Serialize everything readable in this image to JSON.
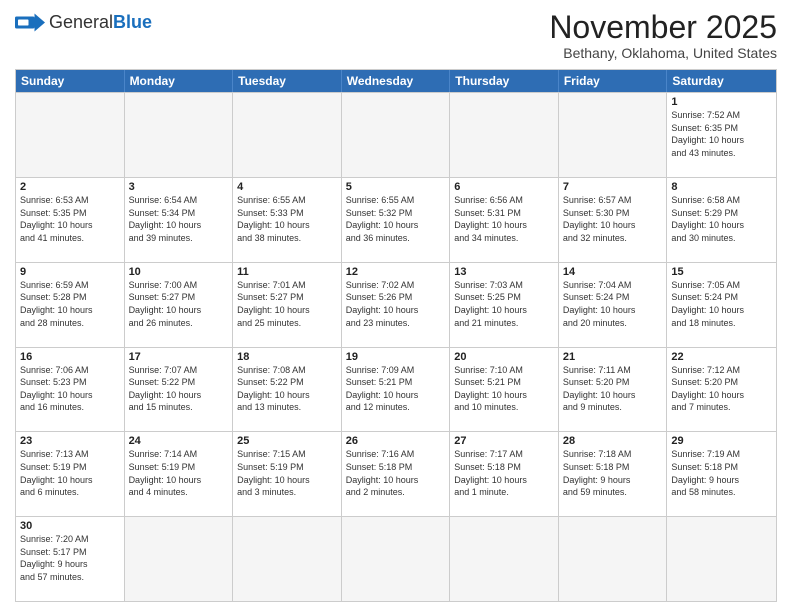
{
  "header": {
    "logo_general": "General",
    "logo_blue": "Blue",
    "month_title": "November 2025",
    "subtitle": "Bethany, Oklahoma, United States"
  },
  "days_of_week": [
    "Sunday",
    "Monday",
    "Tuesday",
    "Wednesday",
    "Thursday",
    "Friday",
    "Saturday"
  ],
  "weeks": [
    [
      {
        "day": "",
        "info": "",
        "empty": true
      },
      {
        "day": "",
        "info": "",
        "empty": true
      },
      {
        "day": "",
        "info": "",
        "empty": true
      },
      {
        "day": "",
        "info": "",
        "empty": true
      },
      {
        "day": "",
        "info": "",
        "empty": true
      },
      {
        "day": "",
        "info": "",
        "empty": true
      },
      {
        "day": "1",
        "info": "Sunrise: 7:52 AM\nSunset: 6:35 PM\nDaylight: 10 hours\nand 43 minutes."
      }
    ],
    [
      {
        "day": "2",
        "info": "Sunrise: 6:53 AM\nSunset: 5:35 PM\nDaylight: 10 hours\nand 41 minutes."
      },
      {
        "day": "3",
        "info": "Sunrise: 6:54 AM\nSunset: 5:34 PM\nDaylight: 10 hours\nand 39 minutes."
      },
      {
        "day": "4",
        "info": "Sunrise: 6:55 AM\nSunset: 5:33 PM\nDaylight: 10 hours\nand 38 minutes."
      },
      {
        "day": "5",
        "info": "Sunrise: 6:55 AM\nSunset: 5:32 PM\nDaylight: 10 hours\nand 36 minutes."
      },
      {
        "day": "6",
        "info": "Sunrise: 6:56 AM\nSunset: 5:31 PM\nDaylight: 10 hours\nand 34 minutes."
      },
      {
        "day": "7",
        "info": "Sunrise: 6:57 AM\nSunset: 5:30 PM\nDaylight: 10 hours\nand 32 minutes."
      },
      {
        "day": "8",
        "info": "Sunrise: 6:58 AM\nSunset: 5:29 PM\nDaylight: 10 hours\nand 30 minutes."
      }
    ],
    [
      {
        "day": "9",
        "info": "Sunrise: 6:59 AM\nSunset: 5:28 PM\nDaylight: 10 hours\nand 28 minutes."
      },
      {
        "day": "10",
        "info": "Sunrise: 7:00 AM\nSunset: 5:27 PM\nDaylight: 10 hours\nand 26 minutes."
      },
      {
        "day": "11",
        "info": "Sunrise: 7:01 AM\nSunset: 5:27 PM\nDaylight: 10 hours\nand 25 minutes."
      },
      {
        "day": "12",
        "info": "Sunrise: 7:02 AM\nSunset: 5:26 PM\nDaylight: 10 hours\nand 23 minutes."
      },
      {
        "day": "13",
        "info": "Sunrise: 7:03 AM\nSunset: 5:25 PM\nDaylight: 10 hours\nand 21 minutes."
      },
      {
        "day": "14",
        "info": "Sunrise: 7:04 AM\nSunset: 5:24 PM\nDaylight: 10 hours\nand 20 minutes."
      },
      {
        "day": "15",
        "info": "Sunrise: 7:05 AM\nSunset: 5:24 PM\nDaylight: 10 hours\nand 18 minutes."
      }
    ],
    [
      {
        "day": "16",
        "info": "Sunrise: 7:06 AM\nSunset: 5:23 PM\nDaylight: 10 hours\nand 16 minutes."
      },
      {
        "day": "17",
        "info": "Sunrise: 7:07 AM\nSunset: 5:22 PM\nDaylight: 10 hours\nand 15 minutes."
      },
      {
        "day": "18",
        "info": "Sunrise: 7:08 AM\nSunset: 5:22 PM\nDaylight: 10 hours\nand 13 minutes."
      },
      {
        "day": "19",
        "info": "Sunrise: 7:09 AM\nSunset: 5:21 PM\nDaylight: 10 hours\nand 12 minutes."
      },
      {
        "day": "20",
        "info": "Sunrise: 7:10 AM\nSunset: 5:21 PM\nDaylight: 10 hours\nand 10 minutes."
      },
      {
        "day": "21",
        "info": "Sunrise: 7:11 AM\nSunset: 5:20 PM\nDaylight: 10 hours\nand 9 minutes."
      },
      {
        "day": "22",
        "info": "Sunrise: 7:12 AM\nSunset: 5:20 PM\nDaylight: 10 hours\nand 7 minutes."
      }
    ],
    [
      {
        "day": "23",
        "info": "Sunrise: 7:13 AM\nSunset: 5:19 PM\nDaylight: 10 hours\nand 6 minutes."
      },
      {
        "day": "24",
        "info": "Sunrise: 7:14 AM\nSunset: 5:19 PM\nDaylight: 10 hours\nand 4 minutes."
      },
      {
        "day": "25",
        "info": "Sunrise: 7:15 AM\nSunset: 5:19 PM\nDaylight: 10 hours\nand 3 minutes."
      },
      {
        "day": "26",
        "info": "Sunrise: 7:16 AM\nSunset: 5:18 PM\nDaylight: 10 hours\nand 2 minutes."
      },
      {
        "day": "27",
        "info": "Sunrise: 7:17 AM\nSunset: 5:18 PM\nDaylight: 10 hours\nand 1 minute."
      },
      {
        "day": "28",
        "info": "Sunrise: 7:18 AM\nSunset: 5:18 PM\nDaylight: 9 hours\nand 59 minutes."
      },
      {
        "day": "29",
        "info": "Sunrise: 7:19 AM\nSunset: 5:18 PM\nDaylight: 9 hours\nand 58 minutes."
      }
    ],
    [
      {
        "day": "30",
        "info": "Sunrise: 7:20 AM\nSunset: 5:17 PM\nDaylight: 9 hours\nand 57 minutes."
      },
      {
        "day": "",
        "info": "",
        "empty": true
      },
      {
        "day": "",
        "info": "",
        "empty": true
      },
      {
        "day": "",
        "info": "",
        "empty": true
      },
      {
        "day": "",
        "info": "",
        "empty": true
      },
      {
        "day": "",
        "info": "",
        "empty": true
      },
      {
        "day": "",
        "info": "",
        "empty": true
      }
    ]
  ]
}
